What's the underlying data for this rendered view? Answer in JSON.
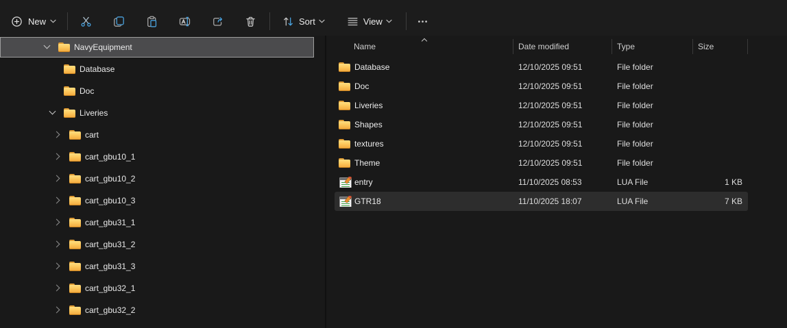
{
  "colors": {
    "accent_blue": "#4aa3e0",
    "folder_yellow": "#f0a63c",
    "tree_selection_gray": "#4b4b4d",
    "row_highlight_gray": "#2d2d2d"
  },
  "toolbar": {
    "new_label": "New",
    "sort_label": "Sort",
    "view_label": "View",
    "icons": {
      "new": "plus-circle-icon",
      "cut": "scissors-icon",
      "copy": "copy-pages-icon",
      "paste": "clipboard-icon",
      "rename": "rename-field-icon",
      "share": "share-arrow-icon",
      "delete": "trash-icon",
      "sort": "up-down-arrows-icon",
      "view": "list-lines-icon",
      "more": "ellipsis-icon"
    }
  },
  "sidebar": {
    "items": [
      {
        "label": "NavyEquipment",
        "level": 0,
        "state": "expanded",
        "selected": true
      },
      {
        "label": "Database",
        "level": 1,
        "state": "leaf"
      },
      {
        "label": "Doc",
        "level": 1,
        "state": "leaf"
      },
      {
        "label": "Liveries",
        "level": 1,
        "state": "expanded"
      },
      {
        "label": "cart",
        "level": 2,
        "state": "collapsed"
      },
      {
        "label": "cart_gbu10_1",
        "level": 2,
        "state": "collapsed"
      },
      {
        "label": "cart_gbu10_2",
        "level": 2,
        "state": "collapsed"
      },
      {
        "label": "cart_gbu10_3",
        "level": 2,
        "state": "collapsed"
      },
      {
        "label": "cart_gbu31_1",
        "level": 2,
        "state": "collapsed"
      },
      {
        "label": "cart_gbu31_2",
        "level": 2,
        "state": "collapsed"
      },
      {
        "label": "cart_gbu31_3",
        "level": 2,
        "state": "collapsed"
      },
      {
        "label": "cart_gbu32_1",
        "level": 2,
        "state": "collapsed"
      },
      {
        "label": "cart_gbu32_2",
        "level": 2,
        "state": "collapsed"
      }
    ]
  },
  "files": {
    "columns": [
      {
        "label": "Name",
        "sort": "asc"
      },
      {
        "label": "Date modified"
      },
      {
        "label": "Type"
      },
      {
        "label": "Size"
      }
    ],
    "rows": [
      {
        "name": "Database",
        "icon": "folder",
        "date": "12/10/2025 09:51",
        "type": "File folder",
        "size": ""
      },
      {
        "name": "Doc",
        "icon": "folder",
        "date": "12/10/2025 09:51",
        "type": "File folder",
        "size": ""
      },
      {
        "name": "Liveries",
        "icon": "folder",
        "date": "12/10/2025 09:51",
        "type": "File folder",
        "size": ""
      },
      {
        "name": "Shapes",
        "icon": "folder",
        "date": "12/10/2025 09:51",
        "type": "File folder",
        "size": ""
      },
      {
        "name": "textures",
        "icon": "folder",
        "date": "12/10/2025 09:51",
        "type": "File folder",
        "size": ""
      },
      {
        "name": "Theme",
        "icon": "folder",
        "date": "12/10/2025 09:51",
        "type": "File folder",
        "size": ""
      },
      {
        "name": "entry",
        "icon": "lua",
        "date": "11/10/2025 08:53",
        "type": "LUA File",
        "size": "1 KB"
      },
      {
        "name": "GTR18",
        "icon": "lua",
        "date": "11/10/2025 18:07",
        "type": "LUA File",
        "size": "7 KB",
        "selected": true
      }
    ]
  }
}
